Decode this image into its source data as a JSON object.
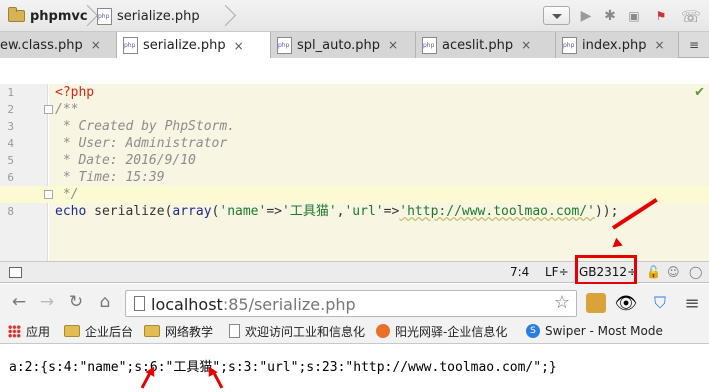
{
  "ide": {
    "breadcrumb": {
      "project": "phpmvc",
      "file": "serialize.php"
    },
    "tabs": [
      {
        "label": "ew.class.php",
        "active": false
      },
      {
        "label": "serialize.php",
        "active": true
      },
      {
        "label": "spl_auto.php",
        "active": false
      },
      {
        "label": "aceslit.php",
        "active": false
      },
      {
        "label": "index.php",
        "active": false
      }
    ],
    "tab_overflow": "≡",
    "tab_close": "×",
    "line_numbers": [
      "1",
      "2",
      "3",
      "4",
      "5",
      "6",
      "7",
      "8"
    ],
    "code": {
      "l1": "<?php",
      "l2": "/**",
      "l3": " * Created by PhpStorm.",
      "l4": " * User: Administrator",
      "l5": " * Date: 2016/9/10",
      "l6": " * Time: 15:39",
      "l7": " */",
      "l8_kw": "echo",
      "l8_fn": " serialize(",
      "l8_kw2": "array",
      "l8_p1": "(",
      "l8_s1": "'name'",
      "l8_op1": "=>",
      "l8_s2": "'工具猫'",
      "l8_c1": ",",
      "l8_s3": "'url'",
      "l8_op2": "=>",
      "l8_s4": "'http://www.toolmao.com/'",
      "l8_end": "));"
    },
    "status": {
      "position": "7:4",
      "line_sep": "LF÷",
      "encoding": "GB2312÷"
    }
  },
  "browser": {
    "url_host": "localhost",
    "url_rest": ":85/serialize.php",
    "bookmarks": [
      "应用",
      "企业后台",
      "网络教学",
      "欢迎访问工业和信息化",
      "阳光网驿-企业信息化",
      "Swiper - Most Mode"
    ],
    "output": "a:2:{s:4:\"name\";s:6:\"工具猫\";s:3:\"url\";s:23:\"http://www.toolmao.com/\";}"
  },
  "colors": {
    "annotation": "#e60000",
    "code_bg": "#f9f5e3"
  }
}
